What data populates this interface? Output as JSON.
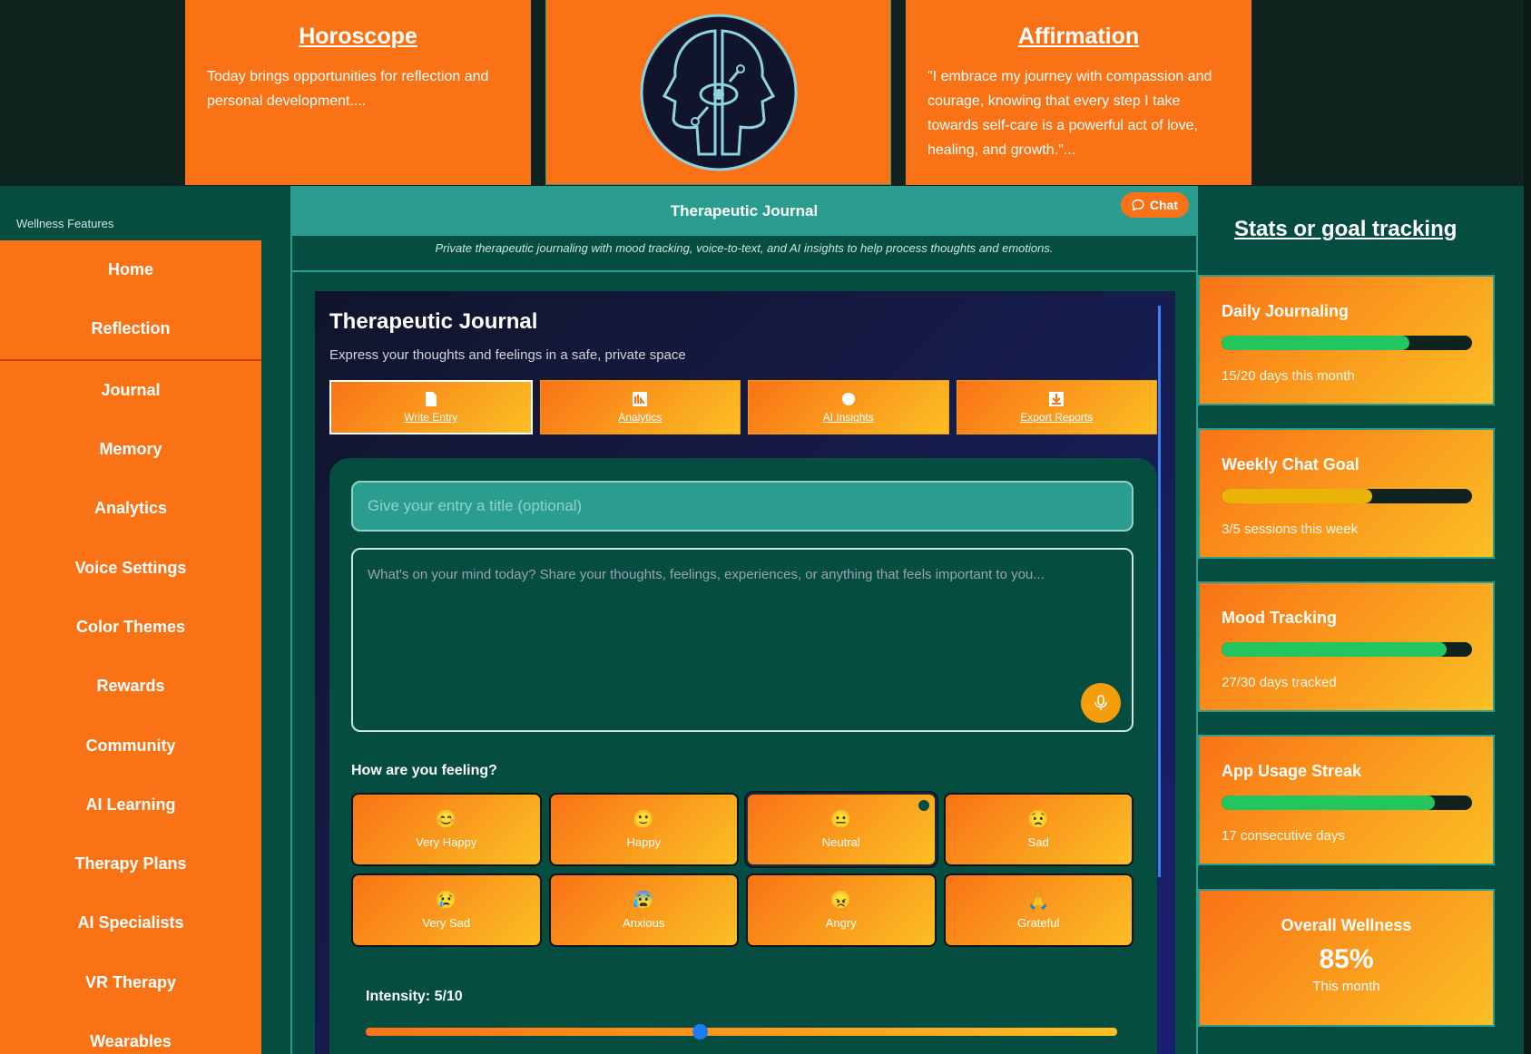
{
  "top": {
    "horoscope": {
      "title": "Horoscope",
      "text": "Today brings opportunities for reflection and personal development...."
    },
    "affirmation": {
      "title": "Affirmation",
      "text": "\"I embrace my journey with compassion and courage, knowing that every step I take towards self-care is a powerful act of love, healing, and growth.\"..."
    }
  },
  "sidebar": {
    "header": "Wellness Features",
    "items": [
      {
        "label": "Home"
      },
      {
        "label": "Reflection"
      },
      {
        "label": "Journal"
      },
      {
        "label": "Memory"
      },
      {
        "label": "Analytics"
      },
      {
        "label": "Voice Settings"
      },
      {
        "label": "Color Themes"
      },
      {
        "label": "Rewards"
      },
      {
        "label": "Community"
      },
      {
        "label": "AI Learning"
      },
      {
        "label": "Therapy Plans"
      },
      {
        "label": "AI Specialists"
      },
      {
        "label": "VR Therapy"
      },
      {
        "label": "Wearables"
      }
    ]
  },
  "main": {
    "header_title": "Therapeutic Journal",
    "chat_label": "Chat",
    "subtitle": "Private therapeutic journaling with mood tracking, voice-to-text, and AI insights to help process thoughts and emotions.",
    "journal": {
      "title": "Therapeutic Journal",
      "description": "Express your thoughts and feelings in a safe, private space",
      "tabs": [
        {
          "label": "Write Entry",
          "icon": "document-icon"
        },
        {
          "label": "Analytics",
          "icon": "chart-icon"
        },
        {
          "label": "AI Insights",
          "icon": "brain-icon"
        },
        {
          "label": "Export Reports",
          "icon": "download-icon"
        }
      ],
      "title_placeholder": "Give your entry a title (optional)",
      "body_placeholder": "What's on your mind today? Share your thoughts, feelings, experiences, or anything that feels important to you...",
      "feeling_label": "How are you feeling?",
      "moods": [
        {
          "emoji": "😊",
          "label": "Very Happy"
        },
        {
          "emoji": "🙂",
          "label": "Happy"
        },
        {
          "emoji": "😐",
          "label": "Neutral"
        },
        {
          "emoji": "😟",
          "label": "Sad"
        },
        {
          "emoji": "😢",
          "label": "Very Sad"
        },
        {
          "emoji": "😰",
          "label": "Anxious"
        },
        {
          "emoji": "😠",
          "label": "Angry"
        },
        {
          "emoji": "🙏",
          "label": "Grateful"
        }
      ],
      "selected_mood": "Neutral",
      "intensity_label": "Intensity: 5/10",
      "intensity_value": 5,
      "intensity_max": 10
    }
  },
  "stats": {
    "title": "Stats or goal tracking",
    "cards": [
      {
        "title": "Daily Journaling",
        "sub": "15/20 days this month",
        "progress": 0.75,
        "color": "#22c55e"
      },
      {
        "title": "Weekly Chat Goal",
        "sub": "3/5 sessions this week",
        "progress": 0.6,
        "color": "#eab308"
      },
      {
        "title": "Mood Tracking",
        "sub": "27/30 days tracked",
        "progress": 0.9,
        "color": "#22c55e"
      },
      {
        "title": "App Usage Streak",
        "sub": "17 consecutive days",
        "progress": 0.85,
        "color": "#22c55e"
      }
    ],
    "wellness": {
      "title": "Overall Wellness",
      "value": "85%",
      "sub": "This month"
    }
  },
  "colors": {
    "accent": "#f97316",
    "teal": "#2a9d8f",
    "panel": "#054d40"
  }
}
